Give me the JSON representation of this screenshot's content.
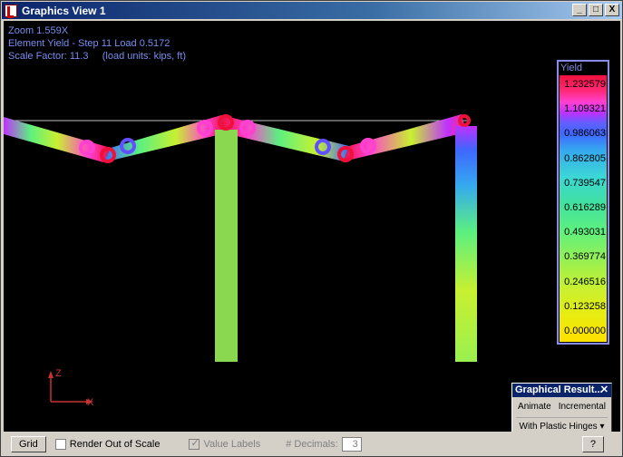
{
  "window": {
    "title": "Graphics View 1",
    "min": "_",
    "max": "□",
    "close": "X"
  },
  "info": {
    "zoom": "Zoom 1.559X",
    "element": "Element Yield - Step 11 Load 0.5172",
    "scale": "Scale Factor: 11.3     (load units: kips, ft)"
  },
  "legend": {
    "title": "Yield",
    "values": [
      "1.232579",
      "1.109321",
      "0.986063",
      "0.862805",
      "0.739547",
      "0.616289",
      "0.493031",
      "0.369774",
      "0.246516",
      "0.123258",
      "0.000000"
    ],
    "top_color": "#f0103c",
    "bottom_color": "#ffe000"
  },
  "axes": {
    "z": "Z",
    "x": "X",
    "color": "#c83232"
  },
  "graphical_results": {
    "title": "Graphical Result...",
    "close": "✕",
    "animate": "Animate",
    "incremental": "Incremental",
    "mode": "With Plastic Hinges"
  },
  "status": {
    "grid": "Grid",
    "render_out_of_scale": "Render Out of Scale",
    "value_labels": "Value Labels",
    "decimals_label": "# Decimals:",
    "decimals_value": "3",
    "help": "?"
  }
}
